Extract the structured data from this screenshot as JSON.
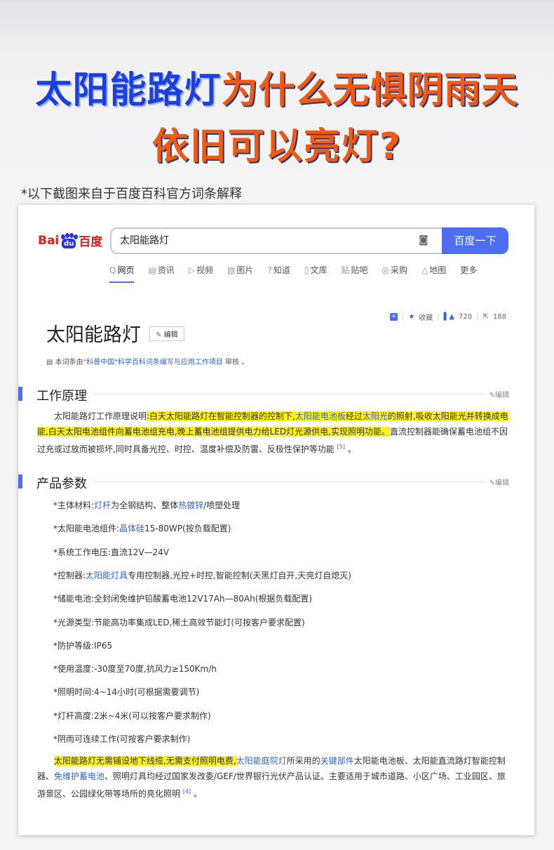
{
  "headline": {
    "line1_blue": "太阳能路灯",
    "line1_orange": "为什么无惧阴雨天",
    "line2": "依旧可以亮灯?"
  },
  "note": "*以下截图来自于百度百科官方词条解释",
  "baidu": {
    "logo_left": "Bai",
    "logo_paw": "du",
    "logo_right": "百度",
    "search_value": "太阳能路灯",
    "search_button": "百度一下",
    "tabs": [
      {
        "icon": "Q",
        "label": "网页"
      },
      {
        "icon": "▤",
        "label": "资讯"
      },
      {
        "icon": "▷",
        "label": "视频"
      },
      {
        "icon": "▨",
        "label": "图片"
      },
      {
        "icon": "?",
        "label": "知道"
      },
      {
        "icon": "▯",
        "label": "文库"
      },
      {
        "icon": "贴",
        "label": "贴吧"
      },
      {
        "icon": "◎",
        "label": "采购"
      },
      {
        "icon": "△",
        "label": "地图"
      },
      {
        "icon": "",
        "label": "更多"
      }
    ]
  },
  "entry": {
    "title": "太阳能路灯",
    "edit_label": "编辑",
    "collect_label": "收藏",
    "like_count": "720",
    "share_count": "188",
    "review_prefix": "本词条由",
    "review_link": "\"科普中国\"科学百科词条编写与应用工作项目",
    "review_suffix": "审核 。"
  },
  "sections": {
    "principle": {
      "title": "工作原理",
      "edit": "编辑",
      "p_intro": "太阳能路灯工作原理说明",
      "p_hl1": ":白天太阳能路灯在智能控制器的控制下,",
      "p_link1": "太阳能电池板",
      "p_hl2": "经过",
      "p_link2": "太阳光",
      "p_hl3": "的照射,吸收太阳能光并转换成电能,白天太阳电池组件向蓄电池组充电,晚上蓄电池组提供电力给LED灯光源供电,实现照明功能。",
      "p_rest": "直流控制器能确保蓄电池组不因过充或过放而被损坏,同时具备光控、时控、温度补偿及防雷、反极性保护等功能",
      "p_ref": "[5]",
      "p_end": " 。"
    },
    "params": {
      "title": "产品参数",
      "edit": "编辑",
      "items": [
        {
          "pre": "*主体材料:",
          "link": "灯杆",
          "mid": "为全钢结构、整体",
          "link2": "热镀锌",
          "post": "/喷塑处理"
        },
        {
          "pre": "*太阳能电池组件:",
          "link": "晶体硅",
          "mid": "15-80WP(按负载配置)",
          "link2": "",
          "post": ""
        },
        {
          "pre": "*系统工作电压:直流12V—24V",
          "link": "",
          "mid": "",
          "link2": "",
          "post": ""
        },
        {
          "pre": "*控制器:",
          "link": "太阳能灯具",
          "mid": "专用控制器,光控+时控,智能控制(天黑灯自开,天亮灯自熄灭)",
          "link2": "",
          "post": ""
        },
        {
          "pre": "*储能电池:全封闭免维护铅酸蓄电池12V17Ah—80Ah(根据负载配置)",
          "link": "",
          "mid": "",
          "link2": "",
          "post": ""
        },
        {
          "pre": "*光源类型:节能高功率集成LED,稀土高效节能灯(可按客户要求配置)",
          "link": "",
          "mid": "",
          "link2": "",
          "post": ""
        },
        {
          "pre": "*防护等级:IP65",
          "link": "",
          "mid": "",
          "link2": "",
          "post": ""
        },
        {
          "pre": "*使用温度:-30度至70度,抗风力≥150Km/h",
          "link": "",
          "mid": "",
          "link2": "",
          "post": ""
        },
        {
          "pre": "*照明时间:4~14小时(可根据需要调节)",
          "link": "",
          "mid": "",
          "link2": "",
          "post": ""
        },
        {
          "pre": "*灯杆高度:2米~4米(可以按客户要求制作)",
          "link": "",
          "mid": "",
          "link2": "",
          "post": ""
        },
        {
          "pre": "*阴雨可连续工作(可按客户要求制作)",
          "link": "",
          "mid": "",
          "link2": "",
          "post": ""
        }
      ],
      "closing_hl": "太阳能路灯无需铺设地下线缆,无需支付照明电费,",
      "closing_link1": "太阳能庭院灯",
      "closing_t1": "所采用的",
      "closing_link2": "关键部件",
      "closing_t2": "太阳能电池板、太阳能直流路灯智能控制器、",
      "closing_link3": "免维护蓄电池",
      "closing_t3": "、照明灯具均经过国家发改委/GEF/世界银行光伏产品认证。主要适用于城市道路、小区广场、工业园区、旅游景区、公园绿化带等场所的亮化照明",
      "closing_ref": "[4]",
      "closing_end": " 。"
    }
  }
}
